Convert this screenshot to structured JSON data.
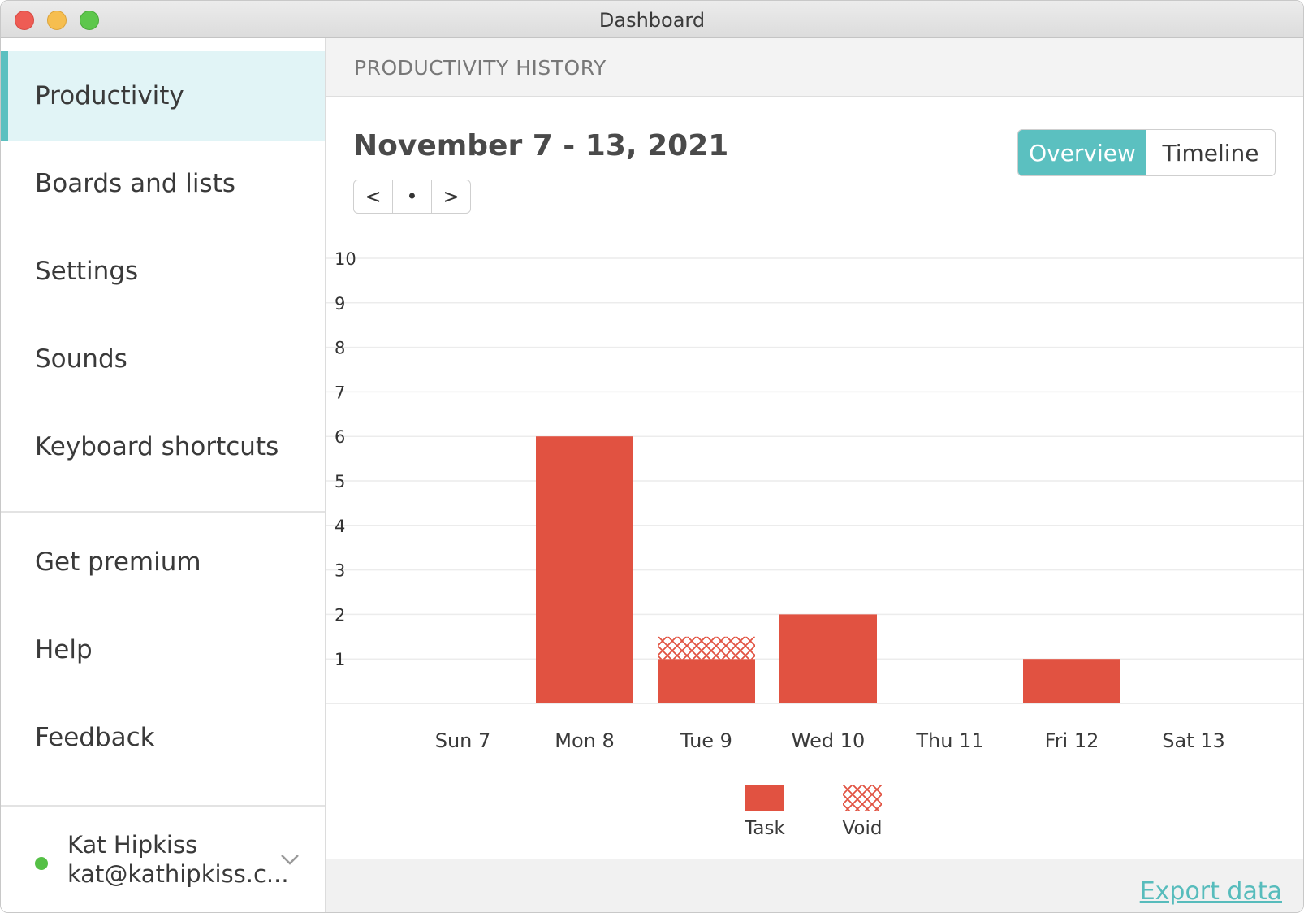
{
  "window": {
    "title": "Dashboard"
  },
  "sidebar": {
    "items": [
      {
        "label": "Productivity",
        "active": true
      },
      {
        "label": "Boards and lists"
      },
      {
        "label": "Settings"
      },
      {
        "label": "Sounds"
      },
      {
        "label": "Keyboard shortcuts"
      },
      {
        "label": "Get premium"
      },
      {
        "label": "Help"
      },
      {
        "label": "Feedback"
      }
    ],
    "user": {
      "name": "Kat Hipkiss",
      "email": "kat@kathipkiss.c...",
      "status_color": "#55c046"
    }
  },
  "header": {
    "section_title": "PRODUCTIVITY HISTORY"
  },
  "main": {
    "date_range": "November 7 - 13, 2021",
    "pager": {
      "prev": "<",
      "current": "•",
      "next": ">"
    },
    "view_toggle": {
      "overview": "Overview",
      "timeline": "Timeline",
      "selected": "overview"
    },
    "export_label": "Export data"
  },
  "colors": {
    "accent": "#5bc0c0",
    "bar": "#e15241",
    "active_bg": "#e1f4f6"
  },
  "chart_data": {
    "type": "bar",
    "categories": [
      "Sun 7",
      "Mon 8",
      "Tue 9",
      "Wed 10",
      "Thu 11",
      "Fri 12",
      "Sat 13"
    ],
    "series": [
      {
        "name": "Task",
        "values": [
          0,
          6,
          1,
          2,
          0,
          1,
          0
        ],
        "color": "#e15241",
        "pattern": "solid"
      },
      {
        "name": "Void",
        "values": [
          0,
          0,
          0.5,
          0,
          0,
          0,
          0
        ],
        "color": "#e15241",
        "pattern": "crosshatch"
      }
    ],
    "stacked": true,
    "yticks": [
      1,
      2,
      3,
      4,
      5,
      6,
      7,
      8,
      9,
      10
    ],
    "ylim": [
      0,
      10
    ],
    "grid": true,
    "legend": "bottom-center"
  }
}
